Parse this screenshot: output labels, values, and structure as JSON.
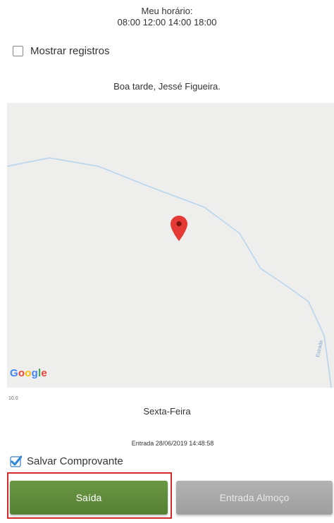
{
  "schedule": {
    "label": "Meu horário:",
    "times": "08:00 12:00 14:00 18:00"
  },
  "show_records": {
    "label": "Mostrar registros",
    "checked": false
  },
  "greeting": "Boa tarde, Jessé Figueira.",
  "map": {
    "provider_logo": "Google",
    "road_label": "Estrada",
    "pin_icon": "location-pin-icon",
    "pin_color": "#e53935",
    "road_color": "#a9cbe9"
  },
  "scale_label": "10.0",
  "weekday": "Sexta-Feira",
  "last_record": "Entrada  28/06/2019 14:48:58",
  "save_receipt": {
    "label": "Salvar Comprovante",
    "checked": true
  },
  "buttons": {
    "exit_label": "Saída",
    "lunch_label": "Entrada Almoço",
    "exit_color": "#5f8a3a",
    "lunch_color": "#a9a9a9",
    "highlight_color": "#d42a2a"
  }
}
